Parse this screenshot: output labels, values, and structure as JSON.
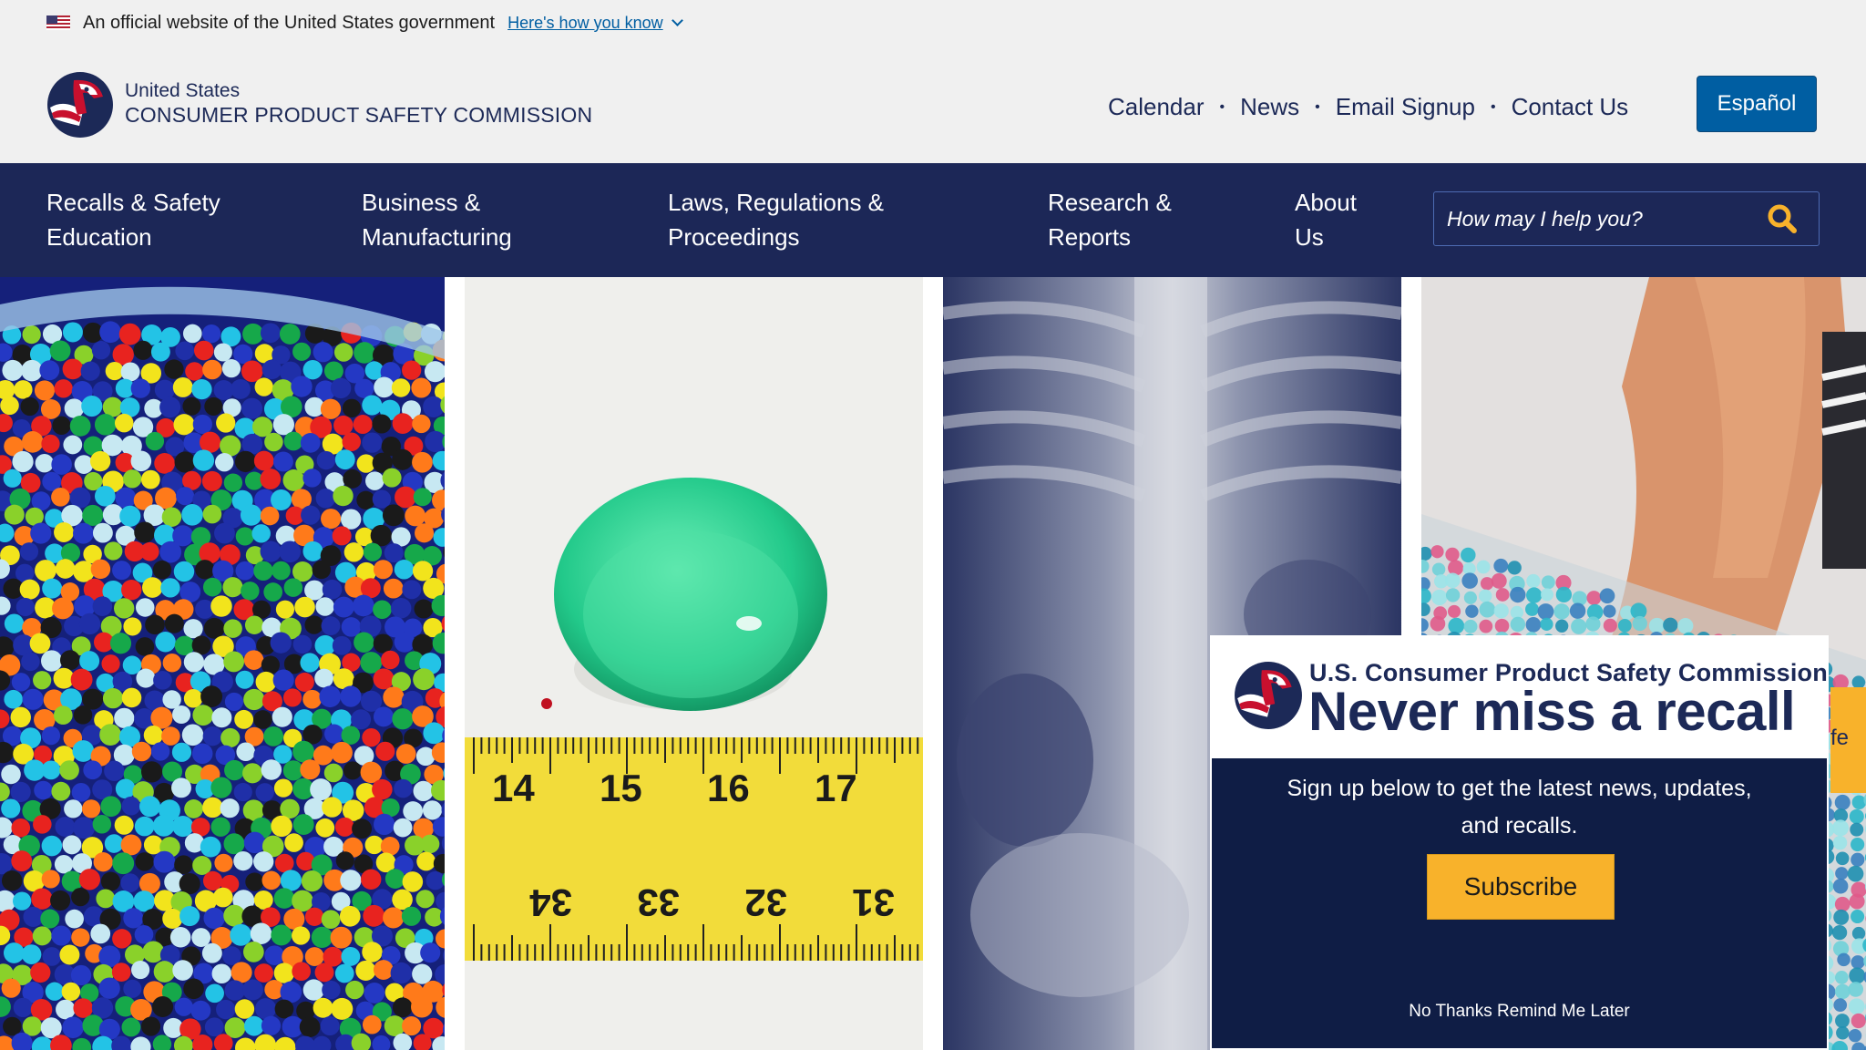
{
  "gov_banner": {
    "official_text": "An official website of the United States government",
    "how_you_know": "Here's how you know"
  },
  "header": {
    "agency_line1": "United States",
    "agency_line2": "CONSUMER PRODUCT SAFETY COMMISSION",
    "util_nav": [
      "Calendar",
      "News",
      "Email Signup",
      "Contact Us"
    ],
    "util_sep": "•",
    "espanol": "Español"
  },
  "main_nav": {
    "items": [
      {
        "line1": "Recalls & Safety",
        "line2": "Education"
      },
      {
        "line1": "Business &",
        "line2": "Manufacturing"
      },
      {
        "line1": "Laws, Regulations &",
        "line2": "Proceedings"
      },
      {
        "line1": "Research &",
        "line2": "Reports"
      },
      {
        "line1": "About",
        "line2": "Us"
      }
    ],
    "search_placeholder": "How may I help you?"
  },
  "hero": {
    "ruler_top": [
      "14",
      "15",
      "16",
      "17"
    ],
    "ruler_bottom": [
      "34",
      "33",
      "32",
      "31"
    ]
  },
  "popup": {
    "agency": "U.S. Consumer Product Safety Commission",
    "title": "Never miss a recall",
    "text_line1": "Sign up below to get the latest news, updates,",
    "text_line2": "and recalls.",
    "subscribe": "Subscribe",
    "no_thanks": "No Thanks Remind Me Later"
  },
  "side_tab": {
    "label": "fe"
  },
  "colors": {
    "navy": "#1c2757",
    "popup_navy": "#0f1d45",
    "primary_blue": "#005ea2",
    "accent_gold": "#f8b22b"
  },
  "icons": {
    "flag": "us-flag-icon",
    "chevron": "chevron-down-icon",
    "search": "search-icon",
    "logo": "cpsc-eagle-logo"
  }
}
